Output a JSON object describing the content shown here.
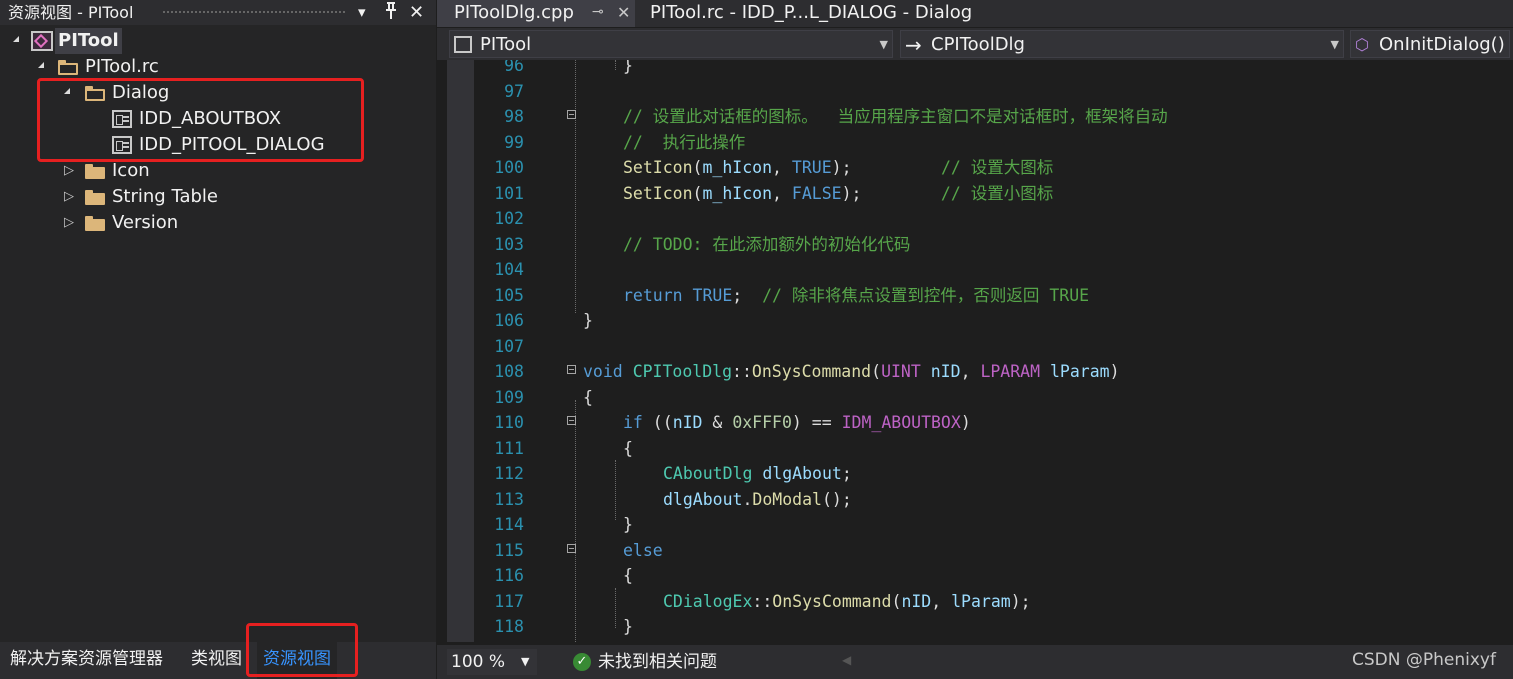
{
  "left_panel": {
    "title": "资源视图 - PITool",
    "dropdown_icon": "▾",
    "pin_icon": "pin",
    "close_icon": "✕",
    "tree": {
      "project": "PITool",
      "rc_file": "PITool.rc",
      "dialog_folder": "Dialog",
      "dialogs": [
        "IDD_ABOUTBOX",
        "IDD_PITOOL_DIALOG"
      ],
      "folders": [
        "Icon",
        "String Table",
        "Version"
      ]
    },
    "bottom_tabs": [
      "解决方案资源管理器",
      "类视图",
      "资源视图"
    ],
    "active_bottom_tab": "资源视图"
  },
  "editor": {
    "tabs": [
      {
        "label": "PIToolDlg.cpp",
        "pin": "⊸",
        "close": "✕"
      },
      {
        "label": "PITool.rc - IDD_P...L_DIALOG - Dialog"
      }
    ],
    "nav": {
      "project": "PITool",
      "class": "CPIToolDlg",
      "member": "OnInitDialog()"
    },
    "line_numbers": [
      "96",
      "97",
      "98",
      "99",
      "100",
      "101",
      "102",
      "103",
      "104",
      "105",
      "106",
      "107",
      "108",
      "109",
      "110",
      "111",
      "112",
      "113",
      "114",
      "115",
      "116",
      "117",
      "118"
    ],
    "code_lines": [
      "}",
      "",
      "// 设置此对话框的图标。  当应用程序主窗口不是对话框时，框架将自动",
      "//  执行此操作",
      "SetIcon(m_hIcon, TRUE);         // 设置大图标",
      "SetIcon(m_hIcon, FALSE);        // 设置小图标",
      "",
      "// TODO: 在此添加额外的初始化代码",
      "",
      "return TRUE;  // 除非将焦点设置到控件，否则返回 TRUE",
      "}",
      "",
      "void CPIToolDlg::OnSysCommand(UINT nID, LPARAM lParam)",
      "{",
      "if ((nID & 0xFFF0) == IDM_ABOUTBOX)",
      "{",
      "CAboutDlg dlgAbout;",
      "dlgAbout.DoModal();",
      "}",
      "else",
      "{",
      "CDialogEx::OnSysCommand(nID, lParam);",
      "}"
    ],
    "status": {
      "zoom": "100 %",
      "issues": "未找到相关问题",
      "watermark": "CSDN @Phenixyf"
    }
  },
  "colors": {
    "keyword": "#569cd6",
    "class": "#4ec9b0",
    "function": "#dcdcaa",
    "comment": "#57a64a",
    "macro": "#bd63c5",
    "line_number": "#2b91af",
    "highlight": "#e62020",
    "active_tab": "#3794ff"
  }
}
